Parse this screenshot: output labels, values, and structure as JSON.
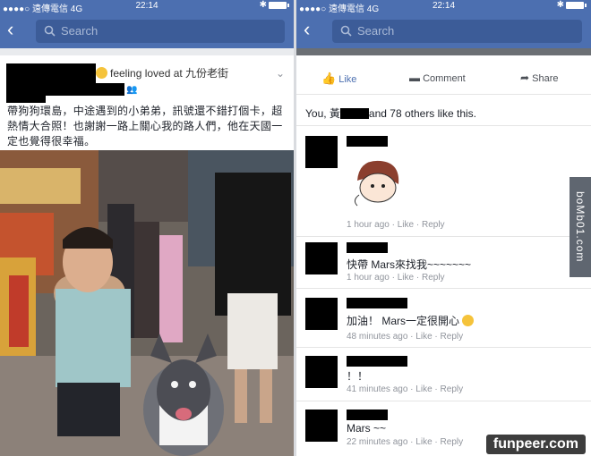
{
  "status_bar": {
    "carrier": "●●●●○ 遠傳電信  4G",
    "time": "22:14"
  },
  "search": {
    "placeholder": "Search"
  },
  "post": {
    "feeling": "feeling loved at 九份老街",
    "text": "帶狗狗環島，中途遇到的小弟弟，訊號還不錯打個卡，超熱情大合照！也謝謝一路上關心我的路人們，他在天國一定也覺得很幸福。"
  },
  "actions": {
    "like": "Like",
    "comment": "Comment",
    "share": "Share"
  },
  "likes": {
    "prefix": "You, 黃",
    "suffix": "and 78 others like this."
  },
  "comments": [
    {
      "text": "",
      "time": "1 hour ago",
      "like": "Like",
      "reply": "Reply"
    },
    {
      "text": "快帶 Mars來找我~~~~~~~",
      "time": "1 hour ago",
      "like": "Like",
      "reply": "Reply"
    },
    {
      "text": "加油！ Mars一定很開心",
      "time": "48 minutes ago",
      "like": "Like",
      "reply": "Reply"
    },
    {
      "text": "！！",
      "time": "41 minutes ago",
      "like": "Like",
      "reply": "Reply"
    },
    {
      "text": "Mars ~~",
      "time": "22 minutes ago",
      "like": "Like",
      "reply": "Reply"
    }
  ],
  "watermarks": {
    "side": "boMb01.com",
    "bottom": "funpeer.com"
  }
}
